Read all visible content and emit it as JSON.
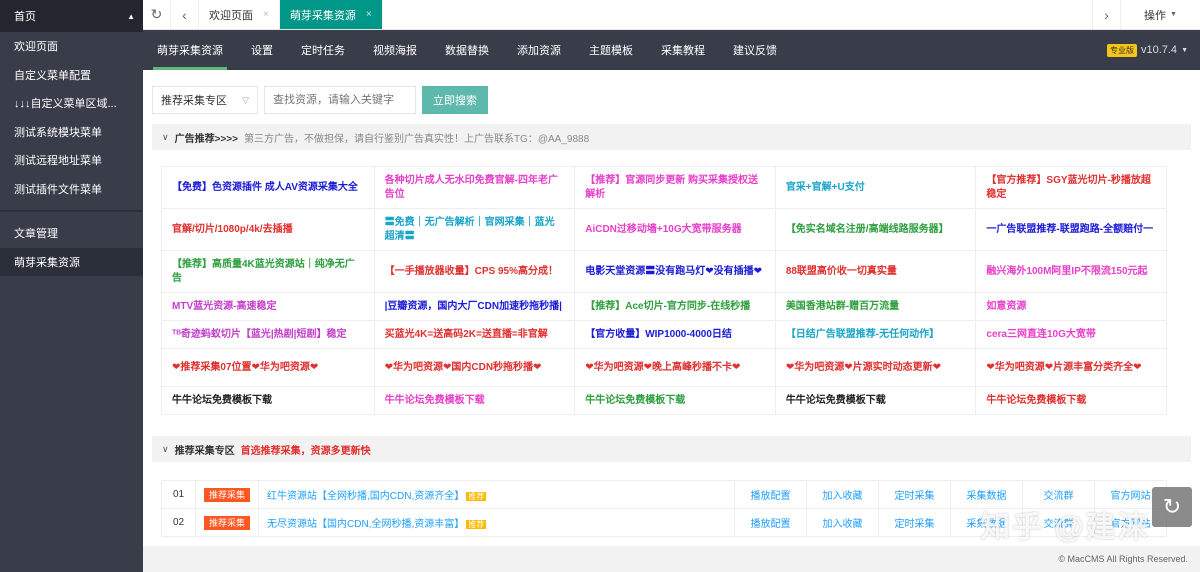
{
  "sidebar": {
    "header": "首页",
    "group1": [
      "欢迎页面",
      "自定义菜单配置",
      "↓↓↓自定义菜单区域...",
      "测试系统模块菜单",
      "测试远程地址菜单",
      "测试插件文件菜单"
    ],
    "group2": [
      "文章管理",
      "萌芽采集资源"
    ]
  },
  "tabs": {
    "items": [
      "欢迎页面",
      "萌芽采集资源"
    ],
    "close": "×",
    "ops_label": "操作"
  },
  "nav": {
    "items": [
      "萌芽采集资源",
      "设置",
      "定时任务",
      "视频海报",
      "数据替换",
      "添加资源",
      "主题模板",
      "采集教程",
      "建议反馈"
    ],
    "pro_badge": "专业版",
    "version": "v10.7.4"
  },
  "search": {
    "select_value": "推荐采集专区",
    "placeholder": "查找资源，请输入关键字",
    "button": "立即搜索"
  },
  "ads": {
    "title": "广告推荐>>>>",
    "note": "第三方广告，不做担保，请自行鉴别广告真实性！上广告联系TG：@AA_9888",
    "rows": [
      [
        {
          "text": "【免费】色资源插件 成人AV资源采集大全",
          "color": "#1b1bd6"
        },
        {
          "text": "各种切片成人无水印免费官解-四年老广告位",
          "color": "#e83ec9"
        },
        {
          "text": "【推荐】官源同步更新 购买采集授权送解析",
          "color": "#e83ec9"
        },
        {
          "text": "官采+官解+U支付",
          "color": "#19a5c9"
        },
        {
          "text": "【官方推荐】SGY蓝光切片-秒播放超稳定",
          "color": "#e0302f"
        }
      ],
      [
        {
          "text": "官解/切片/1080p/4k/去插播",
          "color": "#e0302f"
        },
        {
          "text": "〓免费｜无广告解析｜官网采集｜蓝光超清〓",
          "color": "#19a5c9"
        },
        {
          "text": "AiCDN过移动墙+10G大宽带服务器",
          "color": "#e83ec9"
        },
        {
          "text": "【免实名域名注册/高端线路服务器】",
          "color": "#2e9e3e"
        },
        {
          "text": "一广告联盟推荐-联盟跑路-全额赔付一",
          "color": "#1b1bd6"
        }
      ],
      [
        {
          "text": "【推荐】高质量4K蓝光资源站｜纯净无广告",
          "color": "#2e9e3e"
        },
        {
          "text": "【一手播放器收量】CPS 95%高分成！",
          "color": "#e0302f"
        },
        {
          "text": "电影天堂资源〓没有跑马灯❤没有插播❤",
          "color": "#1b1bd6"
        },
        {
          "text": "88联盟高价收一切真实量",
          "color": "#e0302f"
        },
        {
          "text": "融兴海外100M阿里IP不限流150元起",
          "color": "#e83ec9"
        }
      ],
      [
        {
          "text": "MTV蓝光资源-高速稳定",
          "color": "#c23ec9"
        },
        {
          "text": "|豆瓣资源，国内大厂CDN加速秒拖秒播|",
          "color": "#1b1bd6"
        },
        {
          "text": "【推荐】Ace切片-官方同步-在线秒播",
          "color": "#2e9e3e"
        },
        {
          "text": "美国香港站群-赠百万流量",
          "color": "#2e9e3e"
        },
        {
          "text": "如意资源",
          "color": "#e83ec9"
        }
      ],
      [
        {
          "text": "ᵀᴮ奇迹蚂蚁切片【蓝光|热剧|短剧】稳定",
          "color": "#c23ec9"
        },
        {
          "text": "买蓝光4K=送高码2K=送直播=非官解",
          "color": "#e0302f"
        },
        {
          "text": "【官方收量】WIP1000-4000日结",
          "color": "#1b1bd6"
        },
        {
          "text": "【日结广告联盟推荐-无任何动作】",
          "color": "#19a5c9"
        },
        {
          "text": "cera三网直连10G大宽带",
          "color": "#e83ec9"
        }
      ],
      [
        {
          "text": "❤推荐采集07位置❤华为吧资源❤",
          "color": "#e0302f"
        },
        {
          "text": "❤华为吧资源❤国内CDN秒拖秒播❤",
          "color": "#e0302f"
        },
        {
          "text": "❤华为吧资源❤晚上高峰秒播不卡❤",
          "color": "#e0302f"
        },
        {
          "text": "❤华为吧资源❤片源实时动态更新❤",
          "color": "#e0302f"
        },
        {
          "text": "❤华为吧资源❤片源丰富分类齐全❤",
          "color": "#e0302f"
        }
      ],
      [
        {
          "text": "牛牛论坛免费模板下载",
          "color": "#222222"
        },
        {
          "text": "牛牛论坛免费模板下载",
          "color": "#e83ec9"
        },
        {
          "text": "牛牛论坛免费模板下载",
          "color": "#2e9e3e"
        },
        {
          "text": "牛牛论坛免费模板下载",
          "color": "#222222"
        },
        {
          "text": "牛牛论坛免费模板下载",
          "color": "#e0302f"
        }
      ]
    ]
  },
  "recommend": {
    "title": "推荐采集专区",
    "note": "首选推荐采集，资源多更新快",
    "tag": "推荐采集",
    "hot": "推荐",
    "rows": [
      {
        "num": "01",
        "name": "红牛资源站【全网秒播,国内CDN,资源齐全】",
        "actions": [
          "播放配置",
          "加入收藏",
          "定时采集",
          "采集数据",
          "交流群",
          "官方网站"
        ]
      },
      {
        "num": "02",
        "name": "无尽资源站【国内CDN,全网秒播,资源丰富】",
        "actions": [
          "播放配置",
          "加入收藏",
          "定时采集",
          "采集数据",
          "交流群",
          "官方网站"
        ]
      }
    ]
  },
  "footer": "© MacCMS All Rights Reserved.",
  "watermark": "知乎 @建涞"
}
